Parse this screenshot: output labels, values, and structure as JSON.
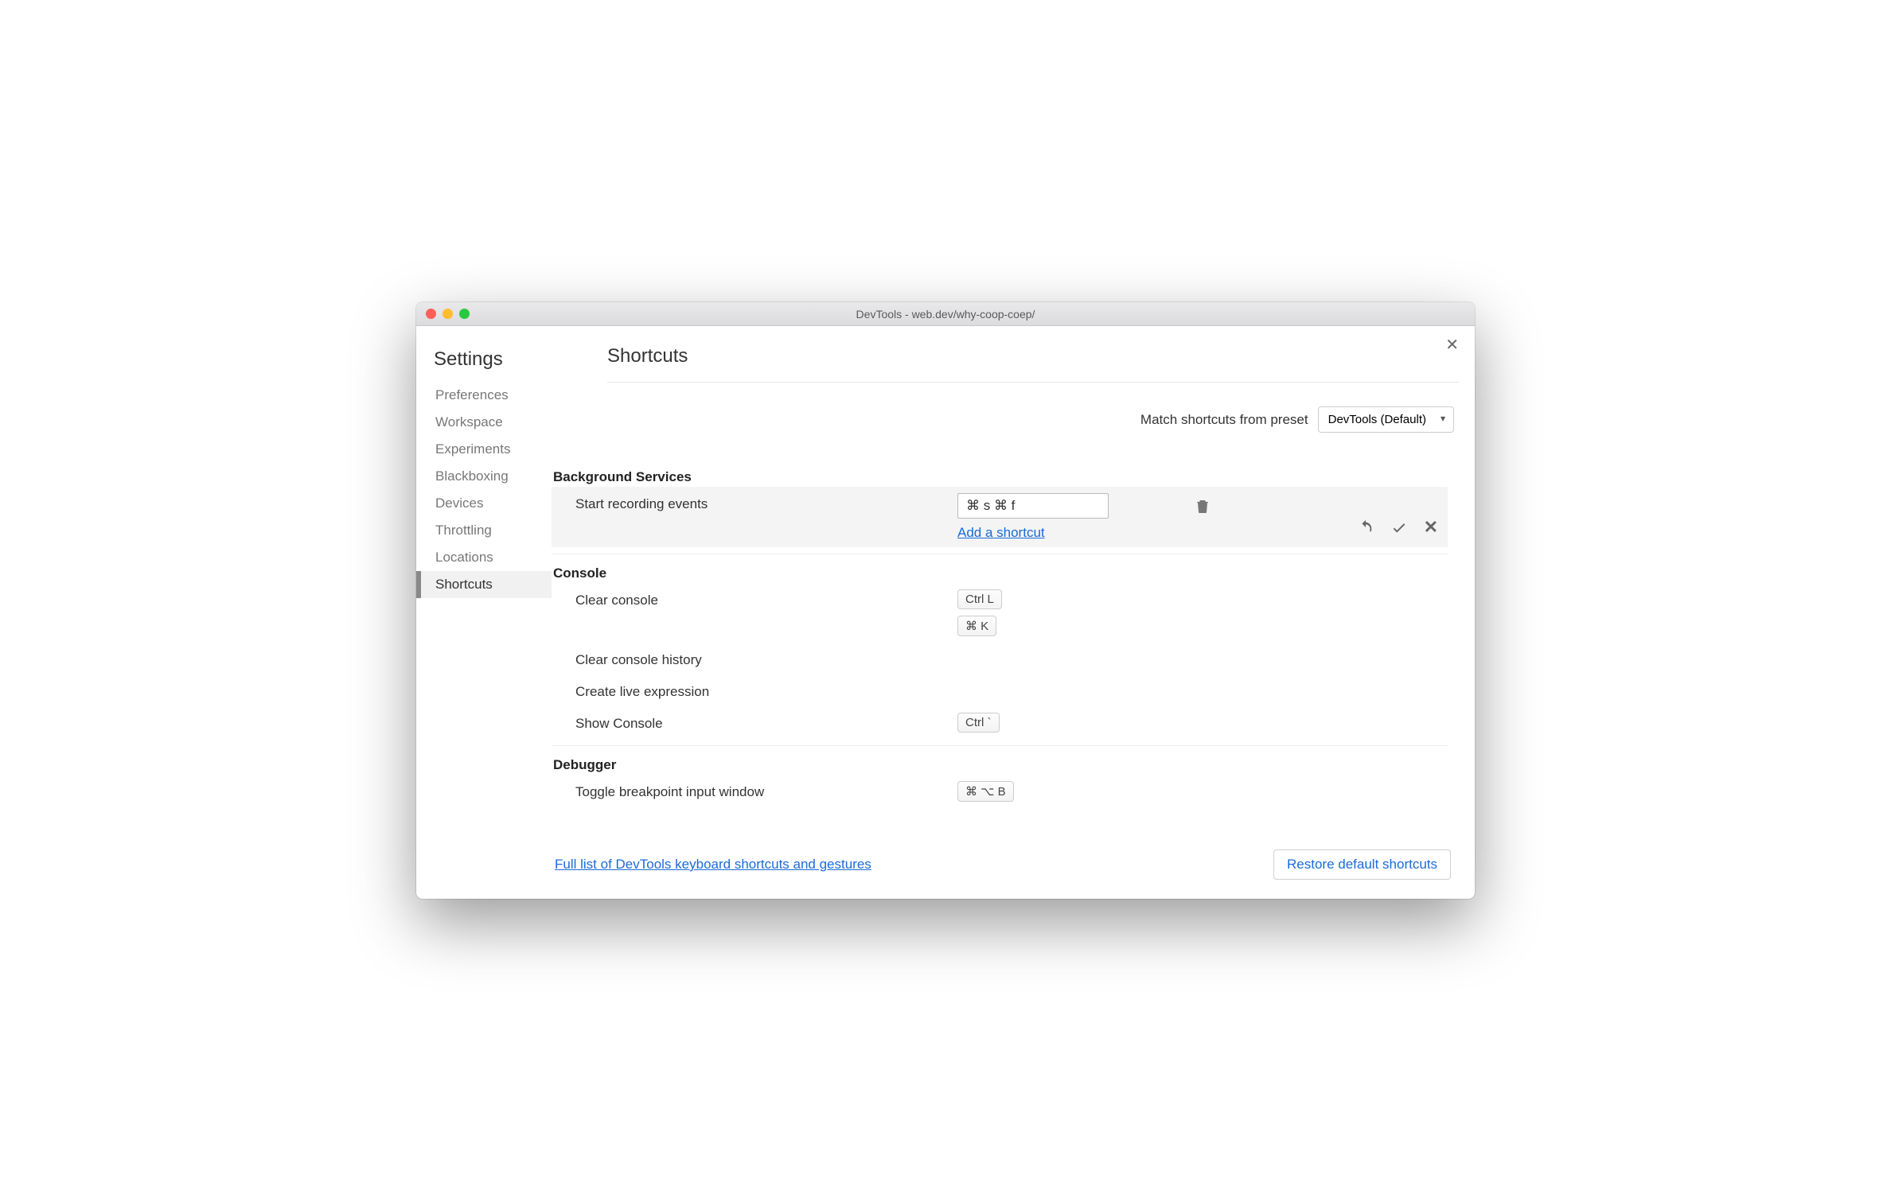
{
  "window_title": "DevTools - web.dev/why-coop-coep/",
  "sidebar": {
    "title": "Settings",
    "items": [
      "Preferences",
      "Workspace",
      "Experiments",
      "Blackboxing",
      "Devices",
      "Throttling",
      "Locations",
      "Shortcuts"
    ],
    "active": "Shortcuts"
  },
  "page": {
    "title": "Shortcuts",
    "preset_label": "Match shortcuts from preset",
    "preset_value": "DevTools (Default)"
  },
  "categories": [
    {
      "name": "Background Services",
      "rows": [
        {
          "label": "Start recording events",
          "editing": true,
          "input_value": "⌘ s ⌘ f",
          "add_link": "Add a shortcut"
        }
      ]
    },
    {
      "name": "Console",
      "rows": [
        {
          "label": "Clear console",
          "keys": [
            "Ctrl L",
            "⌘ K"
          ]
        },
        {
          "label": "Clear console history",
          "keys": []
        },
        {
          "label": "Create live expression",
          "keys": []
        },
        {
          "label": "Show Console",
          "keys": [
            "Ctrl `"
          ]
        }
      ]
    },
    {
      "name": "Debugger",
      "rows": [
        {
          "label": "Toggle breakpoint input window",
          "keys": [
            "⌘ ⌥ B"
          ]
        }
      ]
    }
  ],
  "footer": {
    "link": "Full list of DevTools keyboard shortcuts and gestures",
    "restore": "Restore default shortcuts"
  }
}
